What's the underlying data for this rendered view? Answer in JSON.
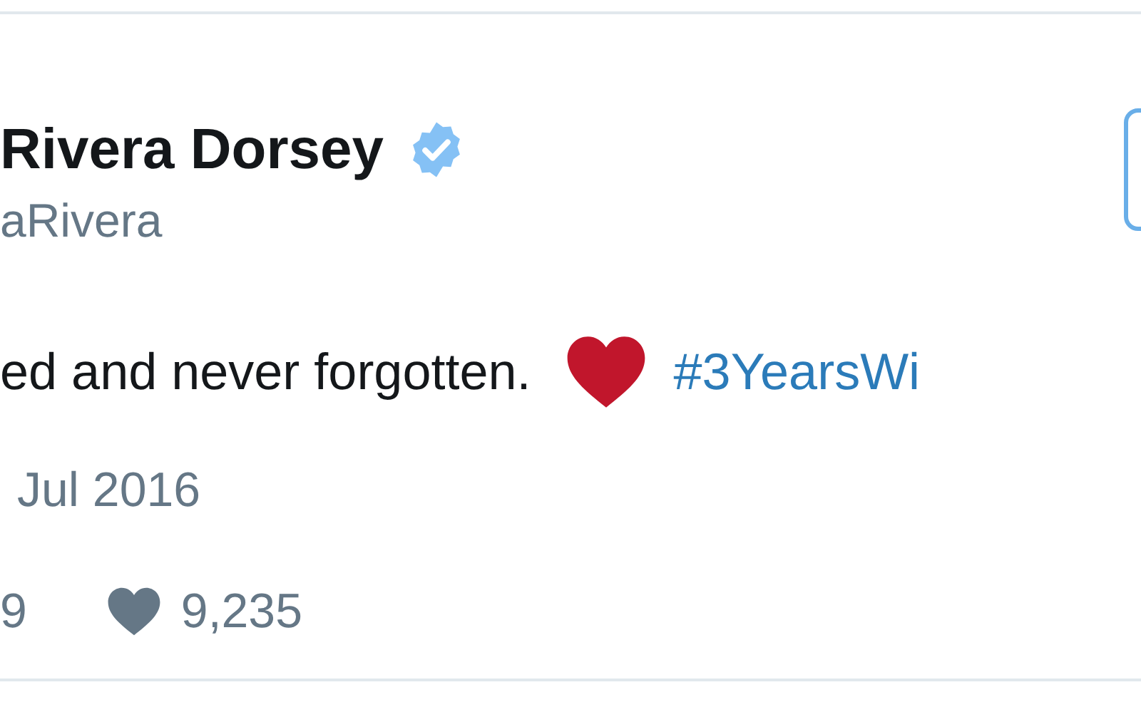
{
  "author": {
    "name": "Rivera Dorsey",
    "verified": true,
    "handle": "aRivera"
  },
  "follow_button": {
    "shown": true
  },
  "tweet": {
    "text": "ed and never forgotten.",
    "hashtag": "#3YearsWi"
  },
  "date": "Jul 2016",
  "stats": [
    {
      "kind": "retweets",
      "count": "9"
    },
    {
      "kind": "likes",
      "count": "9,235"
    }
  ]
}
